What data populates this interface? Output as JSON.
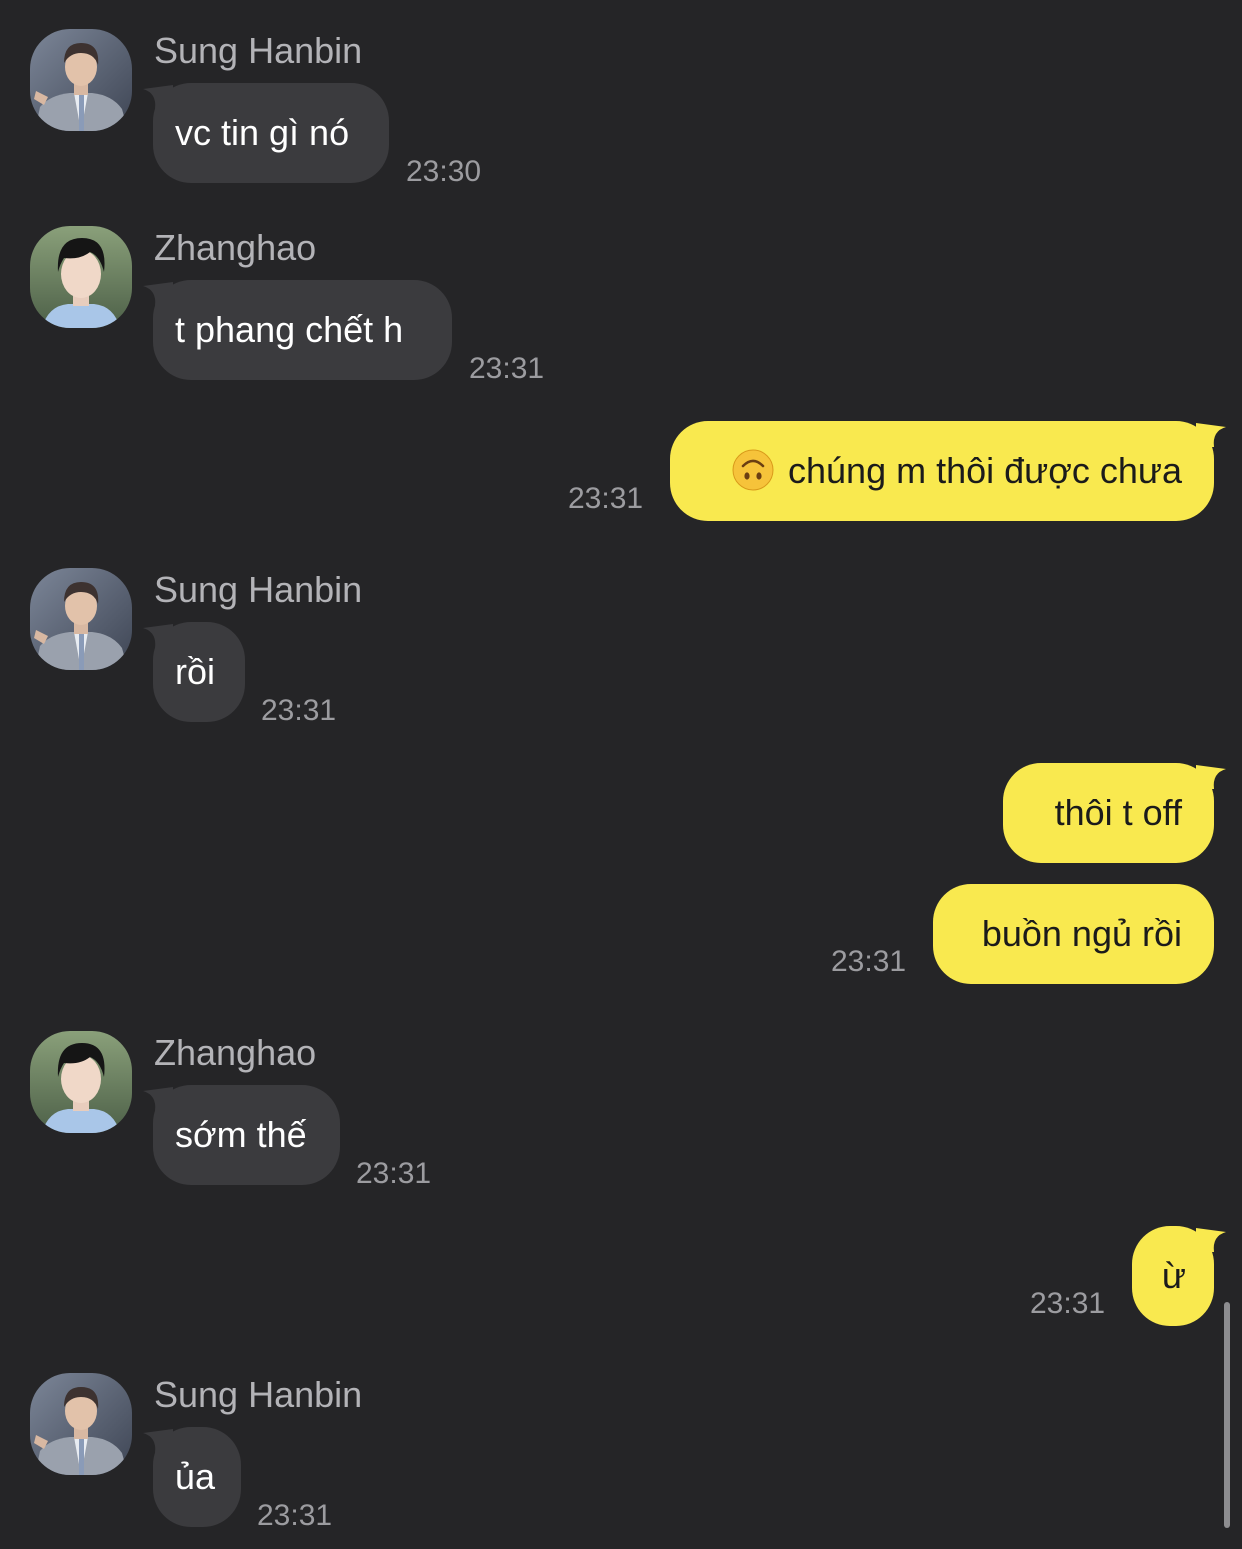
{
  "colors": {
    "background": "#252527",
    "incoming_bubble": "#3b3b3e",
    "outgoing_bubble": "#f9e94f",
    "sender_name": "#b3b3b7",
    "timestamp": "#9c9ca0"
  },
  "messages": [
    {
      "sender": "Sung Hanbin",
      "avatar_icon": "person-avatar-icon",
      "text": "vc tin gì nó",
      "time": "23:30"
    },
    {
      "sender": "Zhanghao",
      "avatar_icon": "person-avatar-icon",
      "text": "t phang chết h",
      "time": "23:31"
    },
    {
      "emoji_icon": "upside-down-face-emoji-icon",
      "text": "chúng m thôi được chưa",
      "time": "23:31"
    },
    {
      "sender": "Sung Hanbin",
      "avatar_icon": "person-avatar-icon",
      "text": "rồi",
      "time": "23:31"
    },
    {
      "text": "thôi t off"
    },
    {
      "text": "buồn ngủ rồi",
      "time": "23:31"
    },
    {
      "sender": "Zhanghao",
      "avatar_icon": "person-avatar-icon",
      "text": "sớm thế",
      "time": "23:31"
    },
    {
      "text": "ừ",
      "time": "23:31"
    },
    {
      "sender": "Sung Hanbin",
      "avatar_icon": "person-avatar-icon",
      "text": "ủa",
      "time": "23:31"
    }
  ]
}
